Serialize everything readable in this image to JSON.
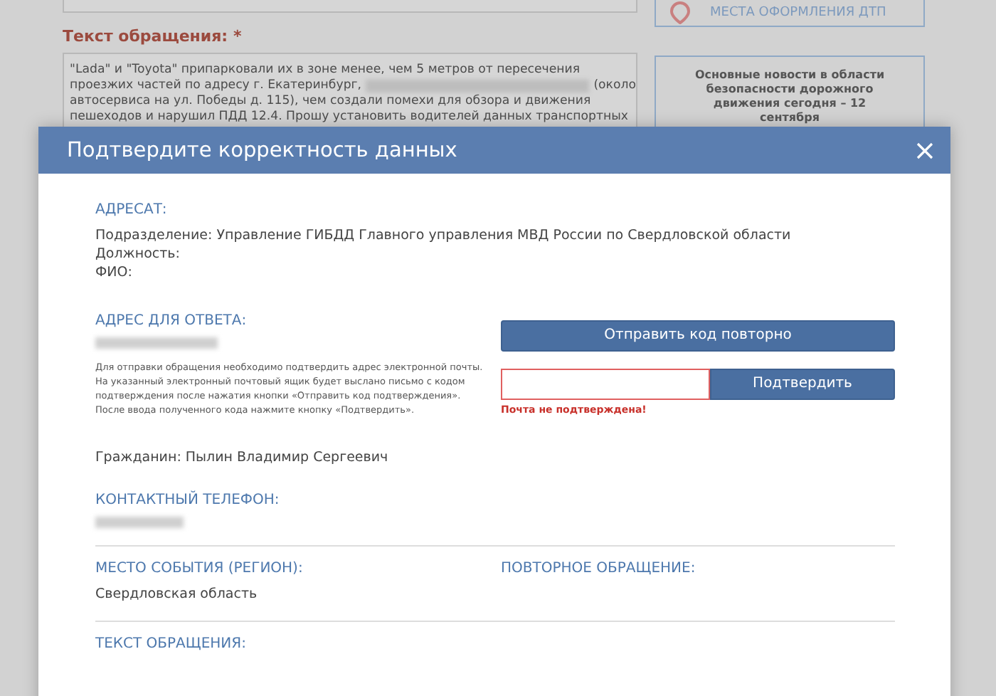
{
  "background_form": {
    "label": "Текст обращения:",
    "required_mark": "*",
    "text_lines": [
      [
        "\"Lada\" и \"Toyota\" припарковали их в зоне менее, чем 5 метров от пересечения"
      ],
      [
        "проезжих частей по адресу г. Екатеринбург,",
        "(около"
      ],
      [
        "автосервиса на ул. Победы д. 115), чем создали помехи для обзора и движения"
      ],
      [
        "пешеходов и нарушил ПДД 12.4. Прошу установить водителей данных транспортных"
      ]
    ]
  },
  "sidebar": {
    "places_link": "МЕСТА ОФОРМЛЕНИЯ ДТП",
    "news_title": "Основные новости в области безопасности дорожного движения сегодня – 12 сентября"
  },
  "modal": {
    "title": "Подтвердите корректность данных",
    "recipient": {
      "heading": "АДРЕСАТ:",
      "lines": [
        "Подразделение: Управление ГИБДД Главного управления МВД России по Свердловской области",
        "Должность:",
        "ФИО:"
      ]
    },
    "reply_address": {
      "heading": "АДРЕС ДЛЯ ОТВЕТА:",
      "hint": "Для отправки обращения необходимо подтвердить адрес электронной почты. На указанный электронный почтовый ящик будет выслано письмо с кодом подтверждения после нажатия кнопки «Отправить код подтверждения». После ввода полученного кода нажмите кнопку «Подтвердить».",
      "resend_button": "Отправить код повторно",
      "confirm_button": "Подтвердить",
      "error": "Почта не подтверждена!",
      "code_invalid": true
    },
    "citizen": "Гражданин: Пылин Владимир Сергеевич",
    "phone": {
      "heading": "КОНТАКТНЫЙ ТЕЛЕФОН:"
    },
    "region": {
      "heading": "МЕСТО СОБЫТИЯ (РЕГИОН):",
      "value": "Свердловская область"
    },
    "repeat": {
      "heading": "ПОВТОРНОЕ ОБРАЩЕНИЕ:"
    },
    "text": {
      "heading": "ТЕКСТ ОБРАЩЕНИЯ:"
    }
  }
}
